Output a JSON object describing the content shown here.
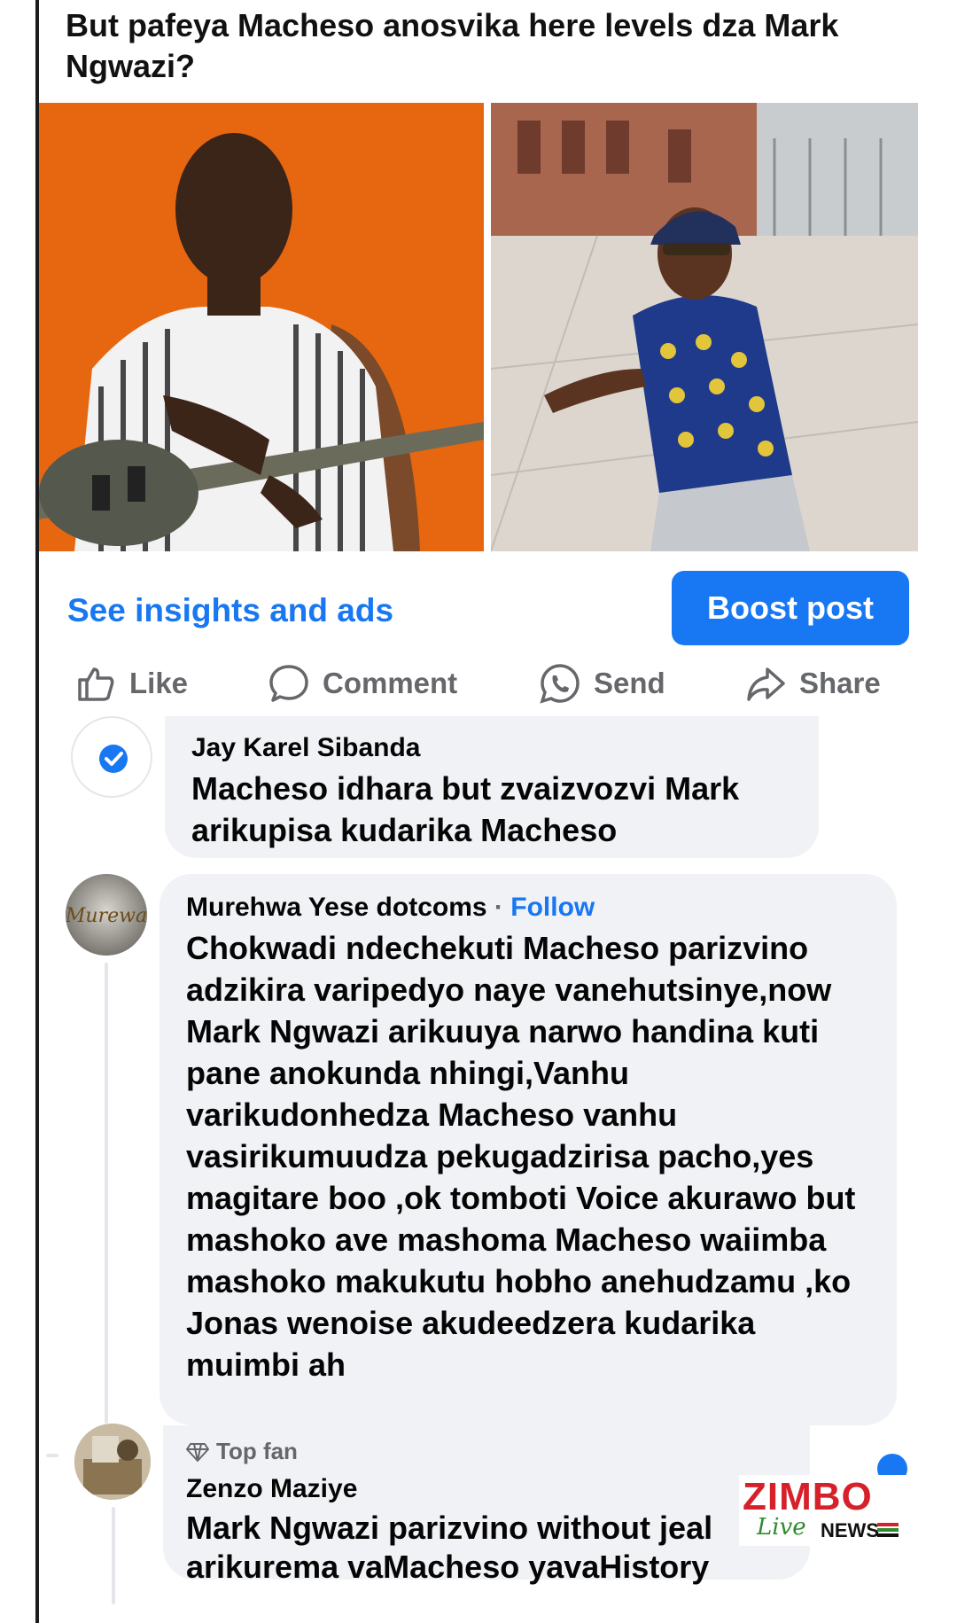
{
  "post": {
    "title": "But pafeya Macheso anosvika here levels dza Mark Ngwazi?"
  },
  "actions_bar": {
    "insights_label": "See insights and ads",
    "boost_label": "Boost post",
    "like_label": "Like",
    "comment_label": "Comment",
    "send_label": "Send",
    "share_label": "Share"
  },
  "comments": [
    {
      "author": "Jay Karel Sibanda",
      "text": "Macheso idhara but zvaizvozvi Mark arikupisa kudarika Macheso"
    },
    {
      "author": "Murehwa Yese dotcoms",
      "separator": "·",
      "follow_label": "Follow",
      "avatar_text": "Murewa",
      "text": "Chokwadi ndechekuti Macheso parizvino adzikira varipedyo naye vanehutsinye,now Mark Ngwazi arikuuya narwo handina kuti pane anokunda nhingi,Vanhu varikudonhedza Macheso vanhu vasirikumuudza pekugadzirisa pacho,yes magitare boo  ,ok tomboti Voice akurawo but mashoko ave mashoma Macheso waiimba mashoko makukutu hobho anehudzamu ,ko Jonas wenoise akudeedzera kudarika muimbi ah"
    },
    {
      "badge": "Top fan",
      "author": "Zenzo Maziye",
      "text": "Mark Ngwazi parizvino without jeal",
      "text_tail": "arikurema vaMacheso yavaHistory"
    }
  ],
  "watermark": {
    "brand": "ZIMBO",
    "live": "Live",
    "news": "NEWS"
  },
  "colors": {
    "accent": "#1877f2",
    "bubble": "#f0f2f5",
    "muted": "#65676b",
    "left_photo_bg": "#e6670f"
  }
}
